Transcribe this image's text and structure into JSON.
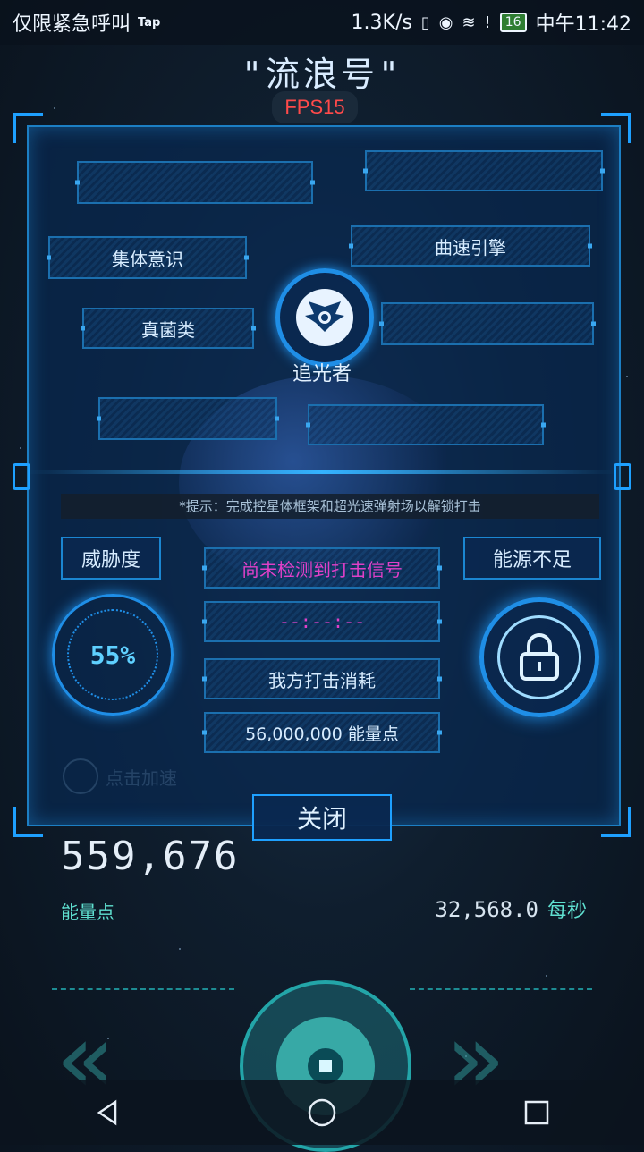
{
  "status_bar": {
    "carrier": "仅限紧急呼叫",
    "tap": "Tap",
    "speed": "1.3K/s",
    "battery": "16",
    "time": "中午11:42"
  },
  "header": {
    "ship_name": "\"流浪号\"",
    "fps": "FPS15"
  },
  "slots": {
    "collective": "集体意识",
    "warp": "曲速引擎",
    "fungi": "真菌类"
  },
  "emblem": {
    "name": "追光者"
  },
  "hint": "*提示：完成控星体框架和超光速弹射场以解锁打击",
  "threat": {
    "label": "威胁度",
    "value": "55%"
  },
  "strike": {
    "signal": "尚未检测到打击信号",
    "timer": "--:--:--",
    "cost_label": "我方打击消耗",
    "cost_value": "56,000,000 能量点"
  },
  "energy_status": "能源不足",
  "close_label": "关闭",
  "accelerate": "点击加速",
  "energy": {
    "amount": "559,676",
    "unit": "能量点",
    "rate": "32,568.0",
    "rate_unit": "每秒"
  },
  "colors": {
    "accent": "#1ea0ff",
    "warning": "#e040c8",
    "teal": "#5fe0d0"
  }
}
